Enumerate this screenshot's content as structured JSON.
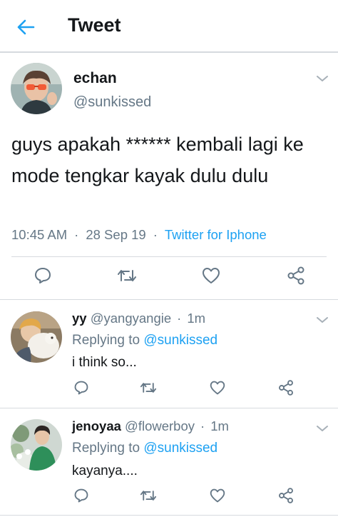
{
  "header": {
    "title": "Tweet"
  },
  "main_tweet": {
    "name": "echan",
    "handle": "@sunkissed",
    "text": "guys apakah ****** kembali lagi ke mode tengkar kayak dulu dulu",
    "time": "10:45 AM",
    "date": "28 Sep 19",
    "source": "Twitter for Iphone",
    "separator": "·"
  },
  "replies": [
    {
      "name": "yy",
      "handle": "@yangyangie",
      "separator": "·",
      "time": "1m",
      "replying_prefix": "Replying to",
      "replying_to": "@sunkissed",
      "text": "i think so..."
    },
    {
      "name": "jenoyaa",
      "handle": "@flowerboy",
      "separator": "·",
      "time": "1m",
      "replying_prefix": "Replying to",
      "replying_to": "@sunkissed",
      "text": "kayanya...."
    }
  ],
  "icons": {
    "back": "arrow-left-icon",
    "more": "chevron-down-icon",
    "reply": "comment-icon",
    "retweet": "retweet-icon",
    "like": "heart-icon",
    "share": "share-icon"
  },
  "colors": {
    "accent": "#1da1f2",
    "secondary_text": "#657786",
    "divider": "#d6dadf"
  }
}
